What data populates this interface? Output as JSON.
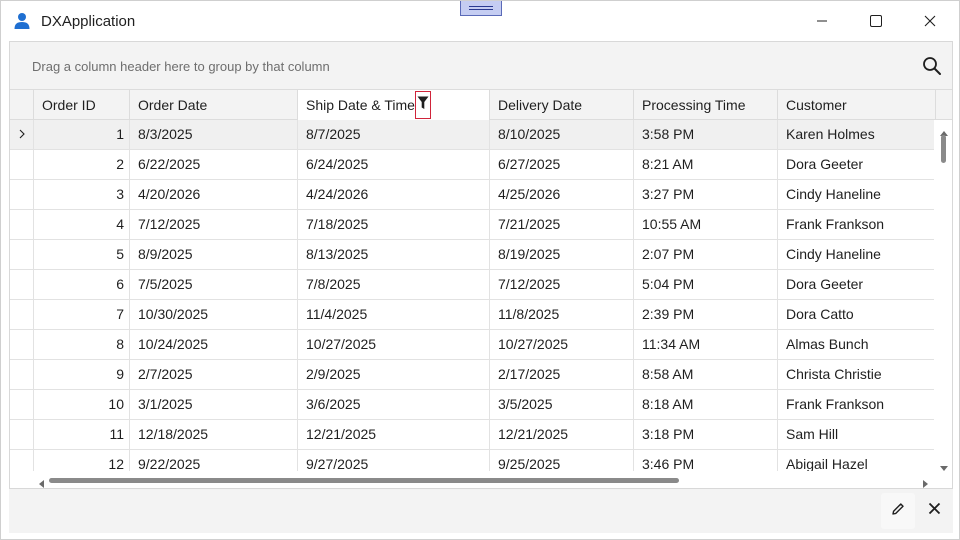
{
  "window": {
    "title": "DXApplication",
    "app_icon": "user-icon",
    "controls": [
      "minimize-icon",
      "maximize-icon",
      "close-icon"
    ]
  },
  "grid": {
    "group_panel_text": "Drag a column header here to group by that column",
    "search_icon": "search-icon",
    "columns": [
      "Order ID",
      "Order Date",
      "Ship Date & Time",
      "Delivery Date",
      "Processing Time",
      "Customer"
    ],
    "filter_icon": "funnel-icon",
    "focused_row_index": 0,
    "rows": [
      [
        "1",
        "8/3/2025",
        "8/7/2025",
        "8/10/2025",
        "3:58 PM",
        "Karen Holmes"
      ],
      [
        "2",
        "6/22/2025",
        "6/24/2025",
        "6/27/2025",
        "8:21 AM",
        "Dora Geeter"
      ],
      [
        "3",
        "4/20/2026",
        "4/24/2026",
        "4/25/2026",
        "3:27 PM",
        "Cindy Haneline"
      ],
      [
        "4",
        "7/12/2025",
        "7/18/2025",
        "7/21/2025",
        "10:55 AM",
        "Frank Frankson"
      ],
      [
        "5",
        "8/9/2025",
        "8/13/2025",
        "8/19/2025",
        "2:07 PM",
        "Cindy Haneline"
      ],
      [
        "6",
        "7/5/2025",
        "7/8/2025",
        "7/12/2025",
        "5:04 PM",
        "Dora Geeter"
      ],
      [
        "7",
        "10/30/2025",
        "11/4/2025",
        "11/8/2025",
        "2:39 PM",
        "Dora Catto"
      ],
      [
        "8",
        "10/24/2025",
        "10/27/2025",
        "10/27/2025",
        "11:34 AM",
        "Almas Bunch"
      ],
      [
        "9",
        "2/7/2025",
        "2/9/2025",
        "2/17/2025",
        "8:58 AM",
        "Christa Christie"
      ],
      [
        "10",
        "3/1/2025",
        "3/6/2025",
        "3/5/2025",
        "8:18 AM",
        "Frank Frankson"
      ],
      [
        "11",
        "12/18/2025",
        "12/21/2025",
        "12/21/2025",
        "3:18 PM",
        "Sam Hill"
      ],
      [
        "12",
        "9/22/2025",
        "9/27/2025",
        "9/25/2025",
        "3:46 PM",
        "Abigail Hazel"
      ]
    ]
  },
  "bottom_bar": {
    "buttons": [
      "pencil-icon",
      "close-icon"
    ]
  },
  "colors": {
    "filter_highlight": "#d0243a",
    "app_icon": "#1f6fd1",
    "panel_bg": "#f3f3f3"
  }
}
